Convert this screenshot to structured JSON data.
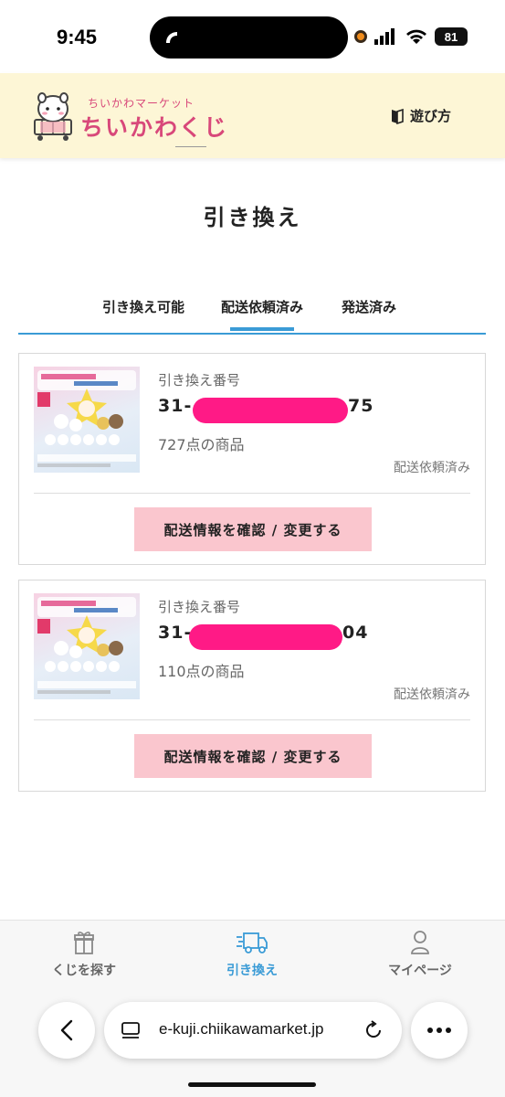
{
  "status_bar": {
    "time": "9:45",
    "battery": "81",
    "icons": [
      "recording-indicator-icon",
      "signal-icon",
      "wifi-icon",
      "battery-icon"
    ]
  },
  "header": {
    "logo_small": "ちいかわマーケット",
    "logo_big": "ちいかわくじ",
    "howto_label": "遊び方",
    "howto_icon": "book-icon"
  },
  "page": {
    "title": "引き換え"
  },
  "tabs": [
    {
      "label": "引き換え可能",
      "active": false
    },
    {
      "label": "配送依頼済み",
      "active": true
    },
    {
      "label": "発送済み",
      "active": false
    }
  ],
  "cards": [
    {
      "number_label": "引き換え番号",
      "number_prefix": "31-",
      "number_suffix": "75",
      "count_text": "727点の商品",
      "status": "配送依頼済み",
      "button_label": "配送情報を確認 / 変更する",
      "thumb_date": "2024.5.26"
    },
    {
      "number_label": "引き換え番号",
      "number_prefix": "31-",
      "number_suffix": "04",
      "count_text": "110点の商品",
      "status": "配送依頼済み",
      "button_label": "配送情報を確認 / 変更する",
      "thumb_date": "2024.5.26"
    }
  ],
  "bottom_nav": [
    {
      "label": "くじを探す",
      "icon": "gift-icon",
      "active": false
    },
    {
      "label": "引き換え",
      "icon": "delivery-truck-icon",
      "active": true
    },
    {
      "label": "マイページ",
      "icon": "person-icon",
      "active": false
    }
  ],
  "browser": {
    "url": "e-kuji.chiikawamarket.jp"
  },
  "colors": {
    "accent_blue": "#3a9bd6",
    "header_bg": "#fdf6d6",
    "logo_pink": "#d8487a",
    "button_pink": "#fac6ce",
    "redaction_pink": "#ff1a86"
  }
}
